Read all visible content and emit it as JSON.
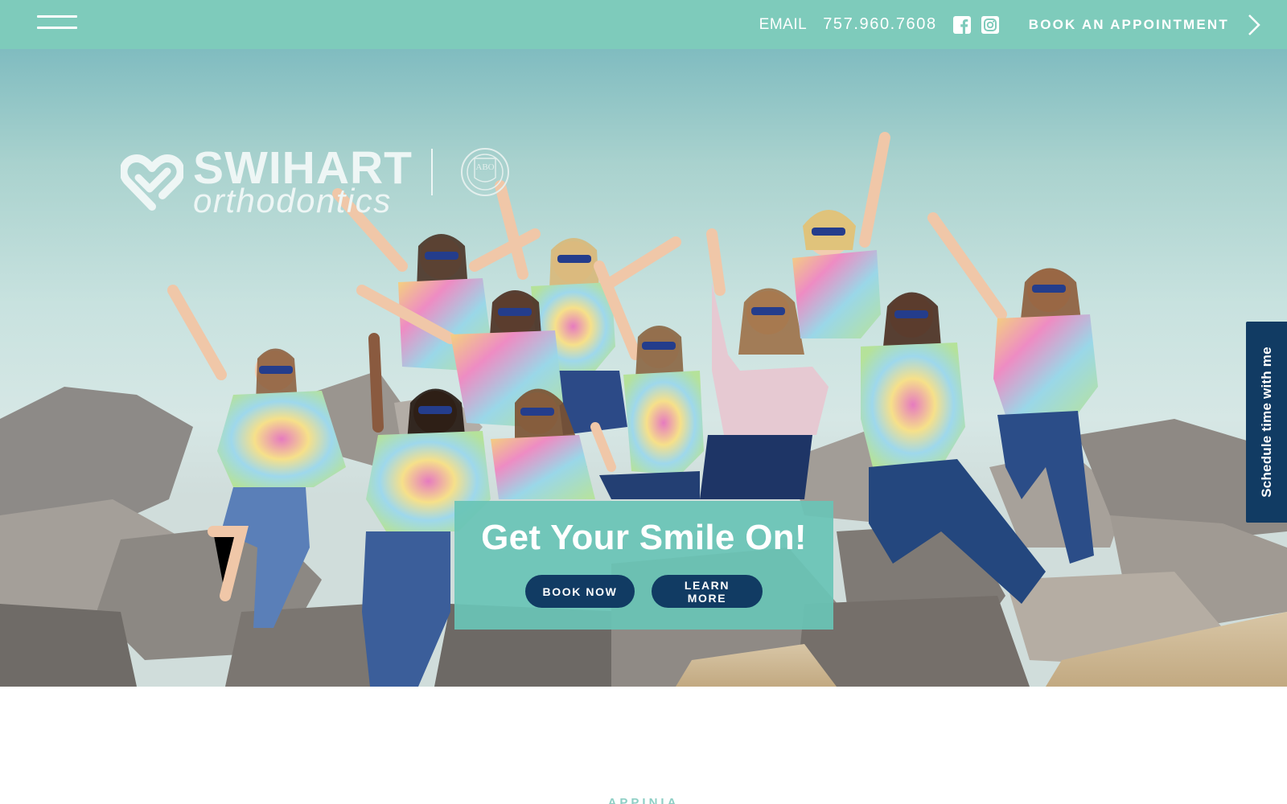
{
  "topbar": {
    "email_label": "EMAIL",
    "phone": "757.960.7608",
    "book_label": "BOOK AN APPOINTMENT",
    "icons": [
      "menu-icon",
      "facebook-icon",
      "instagram-icon",
      "chevron-right-icon"
    ],
    "background_color": "#7ecbbb"
  },
  "logo": {
    "name_line1": "SWIHART",
    "name_line2": "orthodontics",
    "seal_text": "ABO"
  },
  "hero": {
    "headline": "Get Your Smile On!",
    "primary_button": "BOOK NOW",
    "secondary_button": "LEARN MORE",
    "photo_description_icon": "group-photo"
  },
  "side_tab": {
    "label": "Schedule time with me",
    "color": "#113b63"
  },
  "below": {
    "heading": "APPINIA"
  },
  "colors": {
    "accent": "#7ecbbb",
    "navy": "#113b63",
    "cta_background": "#69c4b6"
  }
}
